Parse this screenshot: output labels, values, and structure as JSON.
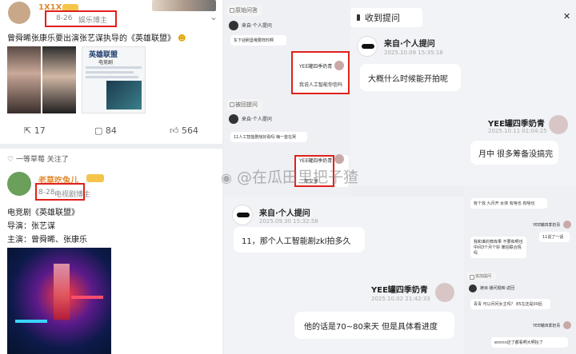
{
  "left_post1": {
    "username": "1X1X",
    "date": "8-26",
    "source": "娱乐博主",
    "text": "曾舜晞张康乐要出演张艺谋执导的《英雄联盟》",
    "poster_title": "英雄联盟",
    "poster_sub": "电竞剧",
    "counts": {
      "share": "17",
      "comment": "84",
      "like": "564"
    }
  },
  "left_post2": {
    "follow_line": "一等草莓 关注了",
    "username": "老草吃兔儿",
    "date": "8-28",
    "source": "电视剧博主",
    "lines": [
      "电竞剧《英雄联盟》",
      "导演：张艺谋",
      "主演：曾舜晞、张康乐"
    ]
  },
  "mid_top": {
    "tag1": "原始问答",
    "q_from": "来自·个人提问",
    "q_text": "东下迎刷垦哦要样时啊",
    "a_name": "YEE罐四季奶青",
    "a_text": "我说人工智能你信吗",
    "tag2": "被回提问",
    "q2_from": "来自·个人提问",
    "q2_text": "11人工智能剧啥好看吗  嗨一首在哭",
    "a2_name": "YEE罐四季奶青",
    "a2_text": "年欠享"
  },
  "right_top": {
    "header": "收到提问",
    "from": "来自·个人提问",
    "time1": "2025.10.09 15:35:18",
    "question": "大概什么时候能开拍呢",
    "name": "YEE罐四季奶青",
    "time2": "2025.10.11 01:04:25",
    "answer": "月中 很多筹备没搞完"
  },
  "mid_bottom": {
    "from": "来自·个人提问",
    "time1": "2025.09.30 15:32:58",
    "question": "11，那个人工智能剧zkl拍多久",
    "name": "YEE罐四季奶青",
    "time2": "2025.10.02 21:42:33",
    "answer": "他的话是70~80来天 但是具体看进度"
  },
  "right_bottom": {
    "b1": "有个找 九月开 女侠 有啥也 有啥也",
    "n1": "YEE罐四季奶青",
    "b2": "11说了一话",
    "b3": "我和谁的荐库果 不要和啊也 中间3个月个好 暖拍联合情吗",
    "tag": "追加提问",
    "n2": "裱目·播问题映·返回",
    "b4": "青青 可以问问女主吗？ 85左还是00后",
    "n3": "YEE罐四季奶青",
    "b5": "ennnn还了都看啊大啊抬了"
  },
  "watermark": "@在瓜田里把子猹",
  "colors": {
    "red_box": "#e0201b",
    "accent_blue": "#4a6cf7",
    "pink": "#ef5b8e"
  }
}
